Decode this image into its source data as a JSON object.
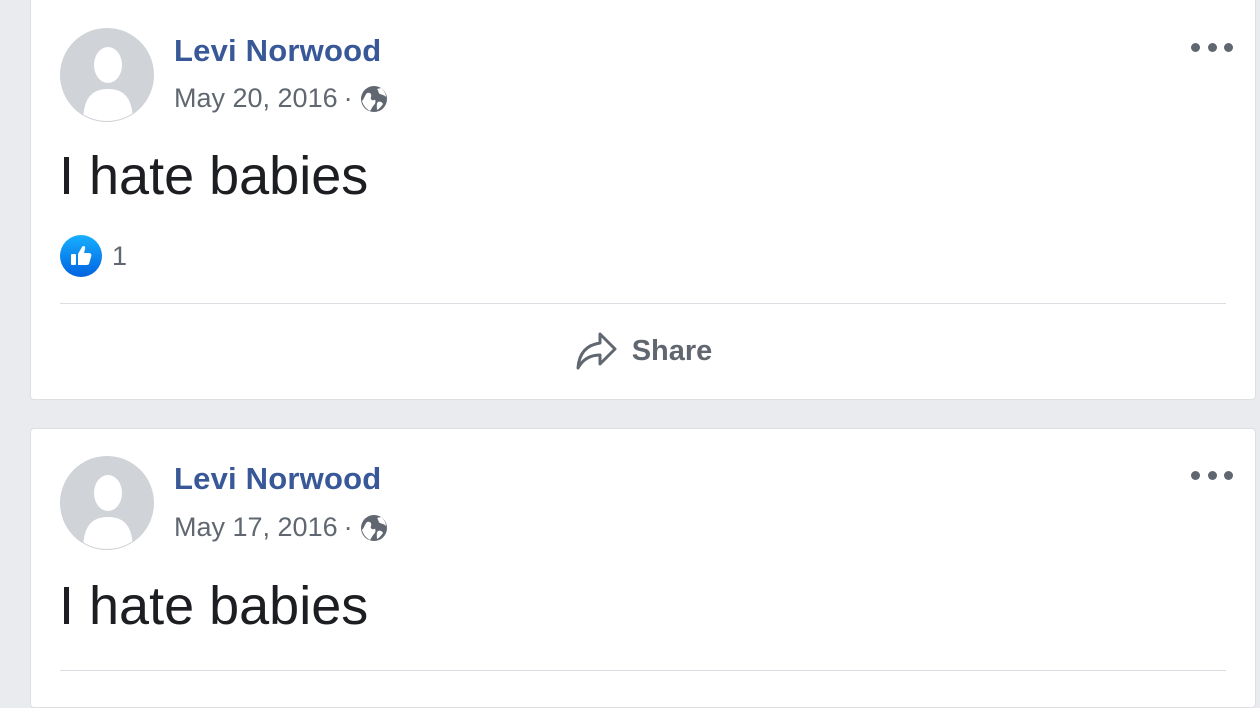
{
  "colors": {
    "page_bg": "#e9ebee",
    "name_link": "#385898",
    "secondary_text": "#606770",
    "like_blue": "#1877f2"
  },
  "posts": [
    {
      "author": "Levi Norwood",
      "date": "May 20, 2016",
      "separator": "·",
      "privacy_icon": "globe-icon",
      "text": "I hate babies",
      "reaction_icon": "like-icon",
      "reaction_count": "1",
      "share_label": "Share"
    },
    {
      "author": "Levi Norwood",
      "date": "May 17, 2016",
      "separator": "·",
      "privacy_icon": "globe-icon",
      "text": "I hate babies"
    }
  ]
}
